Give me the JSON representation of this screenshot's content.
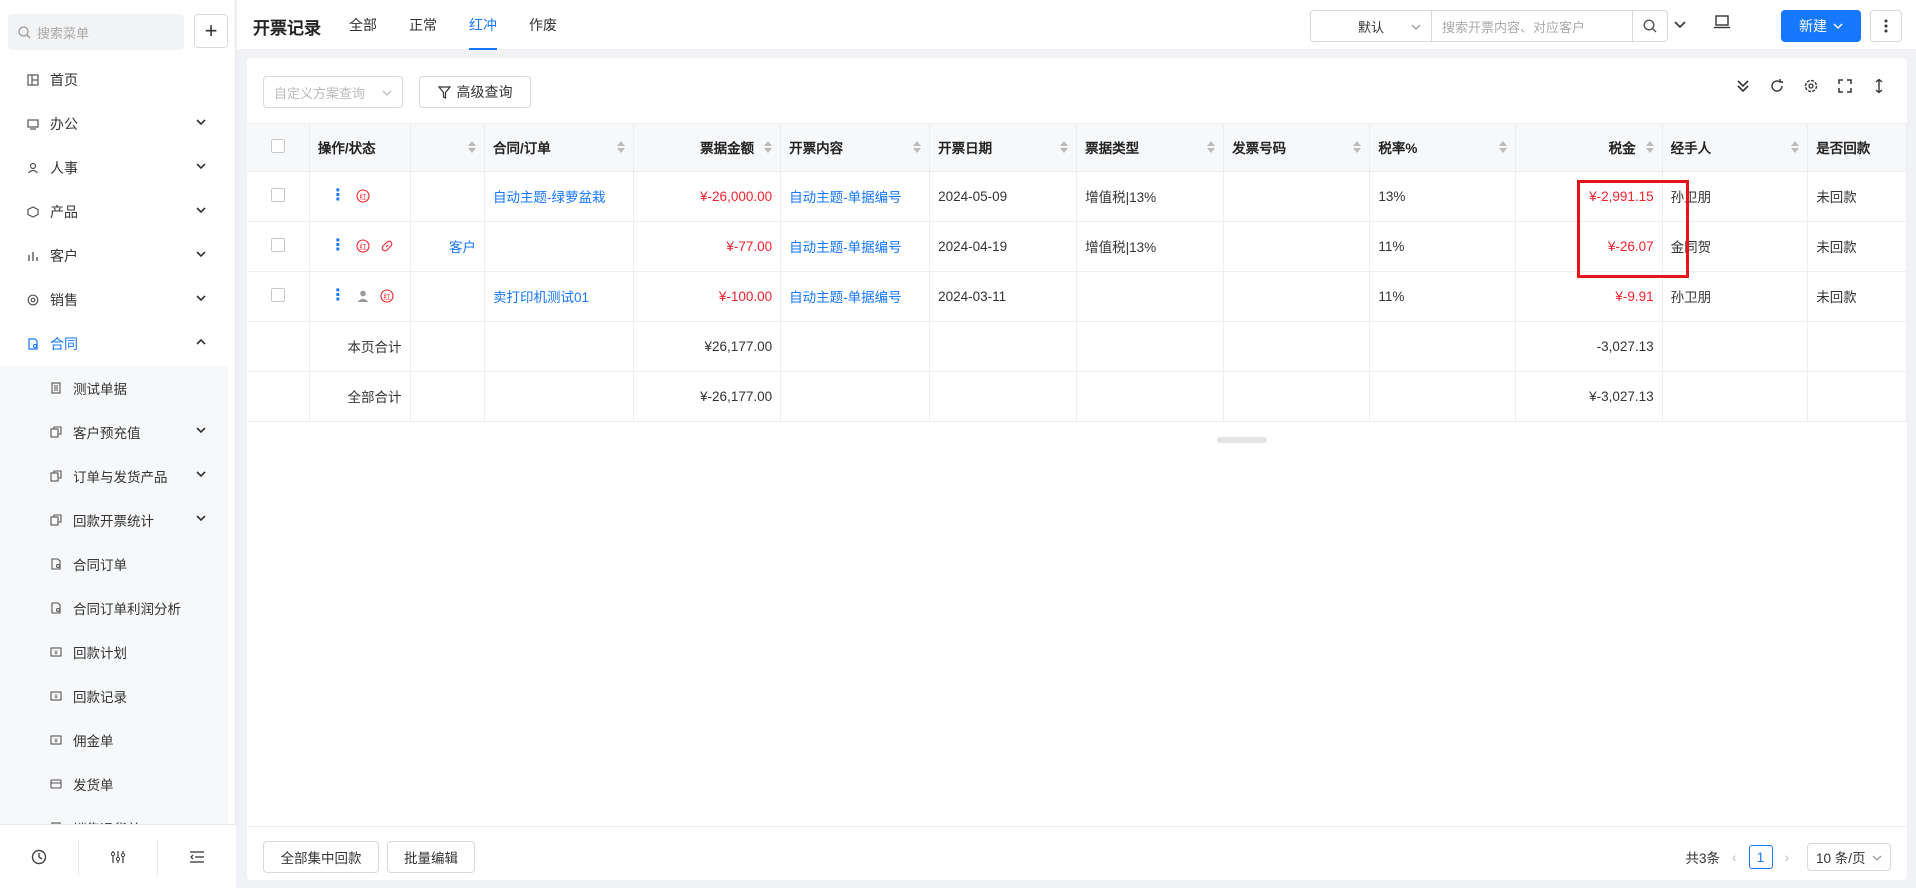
{
  "sidebar": {
    "search_placeholder": "搜索菜单",
    "add_label": "+",
    "items": [
      {
        "label": "首页",
        "icon": "home-icon"
      },
      {
        "label": "办公",
        "icon": "office-icon"
      },
      {
        "label": "人事",
        "icon": "hr-icon"
      },
      {
        "label": "产品",
        "icon": "product-icon"
      },
      {
        "label": "客户",
        "icon": "customer-icon"
      },
      {
        "label": "销售",
        "icon": "sales-icon"
      },
      {
        "label": "合同",
        "icon": "contract-icon"
      }
    ],
    "sub_items": [
      {
        "label": "测试单据"
      },
      {
        "label": "客户预充值"
      },
      {
        "label": "订单与发货产品"
      },
      {
        "label": "回款开票统计"
      },
      {
        "label": "合同订单"
      },
      {
        "label": "合同订单利润分析"
      },
      {
        "label": "回款计划"
      },
      {
        "label": "回款记录"
      },
      {
        "label": "佣金单"
      },
      {
        "label": "发货单"
      },
      {
        "label": "销售退货单"
      }
    ]
  },
  "header": {
    "title": "开票记录",
    "tabs": [
      "全部",
      "正常",
      "红冲",
      "作废"
    ],
    "active_tab": "红冲",
    "view_select": "默认",
    "search_placeholder": "搜索开票内容、对应客户",
    "new_label": "新建"
  },
  "toolbar": {
    "scheme_placeholder": "自定义方案查询",
    "advanced_label": "高级查询"
  },
  "table": {
    "columns": [
      "操作/状态",
      "",
      "合同/订单",
      "票据金额",
      "开票内容",
      "开票日期",
      "票据类型",
      "发票号码",
      "税率%",
      "税金",
      "经手人",
      "是否回款"
    ],
    "rows": [
      {
        "customer": "",
        "contract": "自动主题-绿萝盆栽",
        "amount": "¥-26,000.00",
        "content": "自动主题-单据编号",
        "date": "2024-05-09",
        "type": "增值税|13%",
        "invoice_no": "",
        "rate": "13%",
        "tax": "¥-2,991.15",
        "handler": "孙卫朋",
        "paid": "未回款"
      },
      {
        "customer": "客户",
        "contract": "",
        "amount": "¥-77.00",
        "content": "自动主题-单据编号",
        "date": "2024-04-19",
        "type": "增值税|13%",
        "invoice_no": "",
        "rate": "11%",
        "tax": "¥-26.07",
        "handler": "金同贺",
        "paid": "未回款"
      },
      {
        "customer": "",
        "contract": "卖打印机测试01",
        "amount": "¥-100.00",
        "content": "自动主题-单据编号",
        "date": "2024-03-11",
        "type": "",
        "invoice_no": "",
        "rate": "11%",
        "tax": "¥-9.91",
        "handler": "孙卫朋",
        "paid": "未回款"
      }
    ],
    "page_total": {
      "label": "本页合计",
      "amount": "¥26,177.00",
      "tax": "-3,027.13"
    },
    "all_total": {
      "label": "全部合计",
      "amount": "¥-26,177.00",
      "tax": "¥-3,027.13"
    }
  },
  "footer": {
    "collect_label": "全部集中回款",
    "batch_edit_label": "批量编辑",
    "total_count": "共3条",
    "current_page": "1",
    "page_size": "10 条/页"
  },
  "colors": {
    "accent": "#1677ff",
    "negative": "#f5222d",
    "highlight": "#e5141b"
  }
}
